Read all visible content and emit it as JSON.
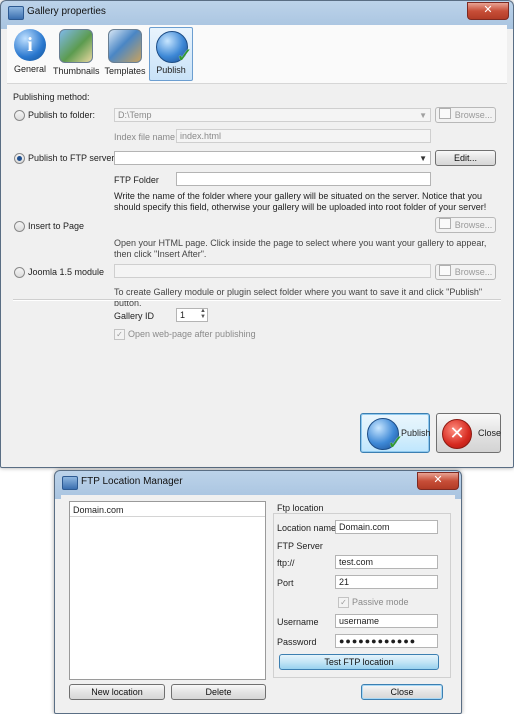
{
  "gallery": {
    "title": "Gallery properties",
    "tabs": [
      {
        "label": "General",
        "icon": "info-icon"
      },
      {
        "label": "Thumbnails",
        "icon": "thumbnails-icon"
      },
      {
        "label": "Templates",
        "icon": "templates-icon"
      },
      {
        "label": "Publish",
        "icon": "publish-globe-icon",
        "active": true
      }
    ],
    "publishing_method_label": "Publishing method:",
    "folder": {
      "radio_label": "Publish to folder:",
      "path": "D:\\Temp",
      "browse": "Browse...",
      "index_label": "Index file name",
      "index_value": "index.html"
    },
    "ftp": {
      "radio_label": "Publish to FTP server",
      "selected": "",
      "edit": "Edit...",
      "folder_label": "FTP Folder",
      "folder_value": "",
      "note": "Write the name of the folder where your gallery will be situated on the server. Notice that you should specify this field, otherwise your gallery will be uploaded into root folder of your server!"
    },
    "insert": {
      "radio_label": "Insert to Page",
      "browse": "Browse...",
      "note": "Open your HTML page. Click inside the page to select where you want your gallery to appear, then click \"Insert After\"."
    },
    "joomla": {
      "radio_label": "Joomla 1.5 module",
      "path": "",
      "browse": "Browse...",
      "note": "To create Gallery module or plugin select folder where you want to save it and click \"Publish\" button."
    },
    "gallery_id_label": "Gallery ID",
    "gallery_id_value": "1",
    "open_webpage_label": "Open web-page after publishing",
    "open_webpage_checked": true,
    "publish_btn": "Publish",
    "close_btn": "Close"
  },
  "ftp_manager": {
    "title": "FTP Location Manager",
    "locations": [
      "Domain.com"
    ],
    "group_label": "Ftp location",
    "location_name_label": "Location name",
    "location_name_value": "Domain.com",
    "ftp_server_label": "FTP Server",
    "ftp_prefix": "ftp://",
    "server_value": "test.com",
    "port_label": "Port",
    "port_value": "21",
    "passive_label": "Passive mode",
    "passive_checked": true,
    "username_label": "Username",
    "username_value": "username",
    "password_label": "Password",
    "password_value": "●●●●●●●●●●●●",
    "test_btn": "Test FTP location",
    "new_btn": "New location",
    "delete_btn": "Delete",
    "close_btn": "Close"
  },
  "colors": {
    "accent": "#3c7fb1",
    "titlebar": "#bcd3ea",
    "close_red": "#c74e38"
  }
}
